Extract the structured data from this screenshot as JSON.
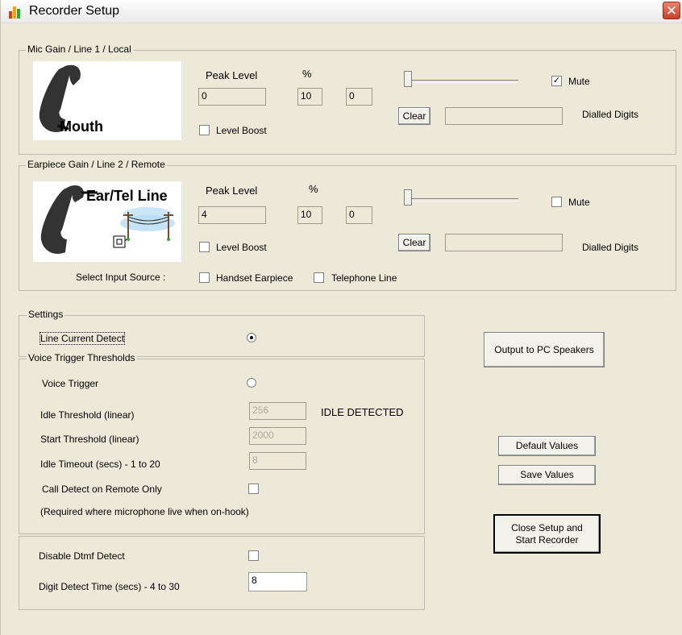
{
  "window": {
    "title": "Recorder Setup",
    "close_glyph": "✕"
  },
  "mic_group": {
    "legend": "Mic Gain / Line 1 / Local",
    "image_label": "Mouth",
    "peak_level_label": "Peak Level",
    "percent_label": "%",
    "peak_level_value": "0",
    "percent_value": "10",
    "third_value": "0",
    "level_boost_label": "Level Boost",
    "level_boost_checked": false,
    "mute_label": "Mute",
    "mute_checked": true,
    "clear_label": "Clear",
    "dialled_digits_value": "",
    "dialled_digits_label": "Dialled Digits",
    "slider_level": 0
  },
  "ear_group": {
    "legend": "Earpiece Gain / Line 2 / Remote",
    "image_label": "Ear/Tel Line",
    "peak_level_label": "Peak Level",
    "percent_label": "%",
    "peak_level_value": "4",
    "percent_value": "10",
    "third_value": "0",
    "level_boost_label": "Level Boost",
    "level_boost_checked": false,
    "mute_label": "Mute",
    "mute_checked": false,
    "clear_label": "Clear",
    "dialled_digits_value": "",
    "dialled_digits_label": "Dialled Digits",
    "slider_level": 0,
    "select_input_source_label": "Select Input Source :",
    "handset_earpiece_label": "Handset Earpiece",
    "telephone_line_label": "Telephone Line"
  },
  "settings": {
    "legend": "Settings",
    "line_current_detect_label": "Line Current Detect",
    "line_current_detect_selected": true
  },
  "voice": {
    "legend": "Voice Trigger Thresholds",
    "voice_trigger_label": "Voice Trigger",
    "voice_trigger_selected": false,
    "idle_threshold_label": "Idle Threshold (linear)",
    "idle_threshold_value": "256",
    "idle_status": "IDLE DETECTED",
    "start_threshold_label": "Start Threshold (linear)",
    "start_threshold_value": "2000",
    "idle_timeout_label": "Idle Timeout (secs) - 1 to 20",
    "idle_timeout_value": "8",
    "call_detect_label": "Call Detect on Remote Only",
    "call_detect_note": "(Required where microphone live when on-hook)"
  },
  "dtmf": {
    "disable_dtmf_label": "Disable Dtmf Detect",
    "digit_detect_label": "Digit Detect Time (secs) - 4 to 30",
    "digit_detect_value": "8"
  },
  "buttons": {
    "output_pc_speakers": "Output to PC Speakers",
    "default_values": "Default Values",
    "save_values": "Save Values",
    "close_setup_line1": "Close Setup and",
    "close_setup_line2": "Start Recorder"
  },
  "colors": {
    "face": "#ece9d8",
    "close": "#d9573f"
  }
}
